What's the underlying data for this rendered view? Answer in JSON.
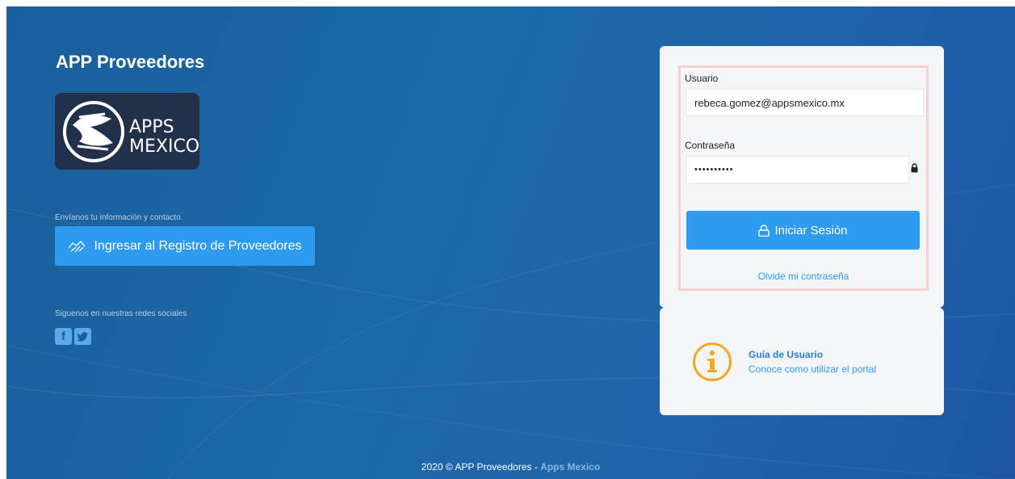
{
  "header": {
    "app_title": "APP Proveedores"
  },
  "logo": {
    "text_top": "APPS",
    "text_bottom": "MEXICO"
  },
  "left": {
    "contact_text": "Envíanos tu información y contacto.",
    "register_button": "Ingresar al Registro de Proveedores",
    "social_text": "Siguenos en nuestras redes sociales",
    "social_icons": [
      "facebook-icon",
      "twitter-icon"
    ]
  },
  "login": {
    "user_label": "Usuario",
    "user_value": "rebeca.gomez@appsmexico.mx",
    "password_label": "Contraseña",
    "password_value": "••••••••••",
    "submit_label": "Iniciar Sesión",
    "forgot_link": "Olvide mi contraseña"
  },
  "guide": {
    "title": "Guía de Usuario",
    "subtitle": "Conoce como utilizar el portal"
  },
  "footer": {
    "copyright": "2020 © APP Proveedores - ",
    "brand": "Apps Mexico"
  },
  "colors": {
    "accent": "#2d9bf0",
    "background": "#1d63a5",
    "card": "#f4f5f7",
    "info_icon": "#f5a623"
  }
}
